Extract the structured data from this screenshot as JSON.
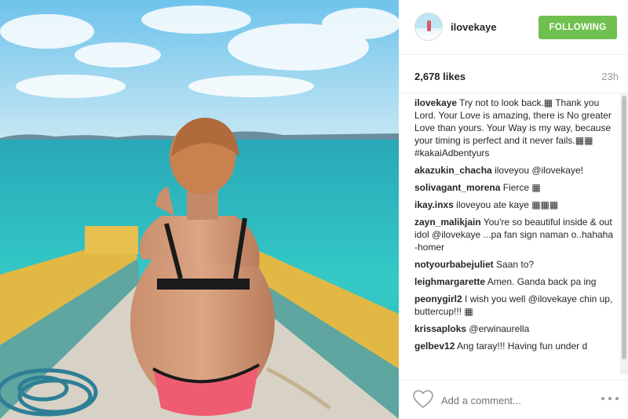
{
  "post": {
    "username": "ilovekaye",
    "follow_label": "FOLLOWING",
    "likes": "2,678 likes",
    "time": "23h",
    "caption": {
      "user": "ilovekaye",
      "text": "Try not to look back.▦ Thank you Lord. Your Love is amazing, there is No greater Love than yours. Your Way is my way, because your timing is perfect and it never fails.▦▦ #kakaiAdbentyurs"
    }
  },
  "comments": [
    {
      "user": "akazukin_chacha",
      "text": "iloveyou @ilovekaye!"
    },
    {
      "user": "solivagant_morena",
      "text": "Fierce ▦"
    },
    {
      "user": "ikay.inxs",
      "text": "iloveyou ate kaye ▦▦▦"
    },
    {
      "user": "zayn_malikjain",
      "text": "You're so beautiful inside & out idol @ilovekaye ...pa fan sign naman o..hahaha -homer"
    },
    {
      "user": "notyourbabejuliet",
      "text": "Saan to?"
    },
    {
      "user": "leighmargarette",
      "text": "Amen. Ganda back pa ing"
    },
    {
      "user": "peonygirl2",
      "text": "I wish you well @ilovekaye chin up, buttercup!!! ▦"
    },
    {
      "user": "krissaploks",
      "text": "@erwinaurella"
    },
    {
      "user": "gelbev12",
      "text": "Ang taray!!! Having fun under d"
    }
  ],
  "footer": {
    "comment_placeholder": "Add a comment...",
    "icons": [
      "heart-icon",
      "more-options-icon"
    ]
  },
  "colors": {
    "follow_button": "#70c050",
    "sea": "#2cc2c0",
    "sky": "#8fd3ea"
  }
}
